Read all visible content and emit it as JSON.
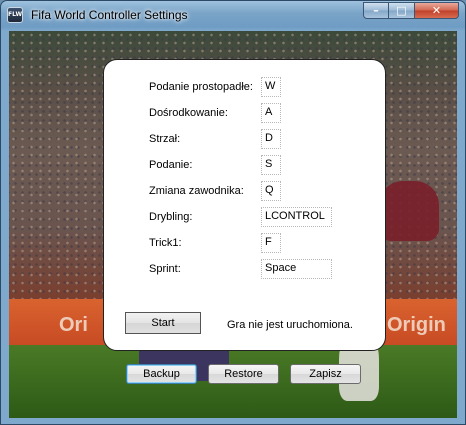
{
  "window": {
    "title": "Fifa World Controller Settings",
    "icon_label": "FLW",
    "controls": {
      "minimize": "–",
      "maximize": "□",
      "close": "✕"
    }
  },
  "background": {
    "ads": [
      "Ori",
      "Origin"
    ]
  },
  "panel": {
    "rows": [
      {
        "label": "Podanie prostopadłe:",
        "value": "W"
      },
      {
        "label": "Dośrodkowanie:",
        "value": "A"
      },
      {
        "label": "Strzał:",
        "value": "D"
      },
      {
        "label": "Podanie:",
        "value": "S"
      },
      {
        "label": "Zmiana zawodnika:",
        "value": "Q"
      },
      {
        "label": "Drybling:",
        "value": "LCONTROL"
      },
      {
        "label": "Trick1:",
        "value": "F"
      },
      {
        "label": "Sprint:",
        "value": "Space"
      }
    ],
    "start_label": "Start",
    "status": "Gra nie jest uruchomiona."
  },
  "buttons": {
    "backup": "Backup",
    "restore": "Restore",
    "save": "Zapisz"
  },
  "colors": {
    "titlebar": "#7aa4c7",
    "close_button": "#c0402a",
    "adboard": "#d6552e"
  }
}
